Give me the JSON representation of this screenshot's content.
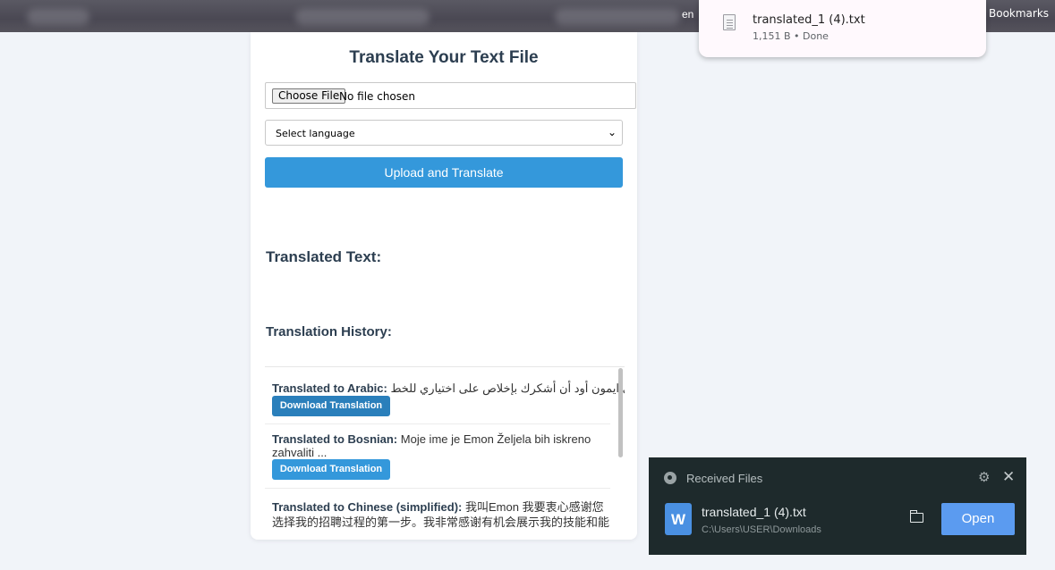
{
  "browser": {
    "partial_text": "en",
    "bookmarks_label": "Bookmarks"
  },
  "download_bubble": {
    "file_name": "translated_1 (4).txt",
    "status": "1,151 B • Done",
    "icon": "document-icon"
  },
  "form": {
    "title": "Translate Your Text File",
    "choose_file_label": "Choose File",
    "no_file_text": "No file chosen",
    "language_select": "Select language",
    "upload_button": "Upload and Translate"
  },
  "sections": {
    "translated_text_heading": "Translated Text:",
    "history_heading": "Translation History:"
  },
  "history": [
    {
      "label": "Translated to Arabic:",
      "text": "اسمي ايمون أود أن أشكرك بإخلاص على اختياري للخط...",
      "button": "Download Translation"
    },
    {
      "label": "Translated to Bosnian:",
      "text": "Moje ime je Emon Željela bih iskreno",
      "text2": "zahvaliti ...",
      "button": "Download Translation"
    },
    {
      "label": "Translated to Chinese (simplified):",
      "text": "我叫Emon 我要衷心感谢您",
      "text2": "选择我的招聘过程的第一步。我非常感谢有机会展示我的技能和能"
    }
  ],
  "received_files": {
    "title": "Received Files",
    "file_name": "translated_1 (4).txt",
    "path": "C:\\Users\\USER\\Downloads",
    "open_button": "Open",
    "file_icon_letter": "W"
  },
  "colors": {
    "primary": "#3498db",
    "heading": "#2c3e50",
    "panel_bg": "#1e2a2c",
    "open_button": "#5b9bf0"
  }
}
